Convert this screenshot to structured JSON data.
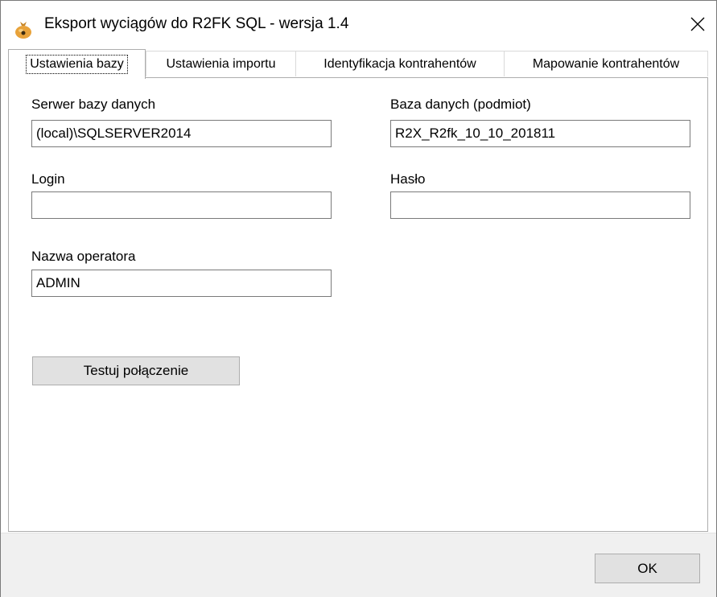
{
  "window": {
    "title": "Eksport wyciągów do R2FK SQL - wersja 1.4",
    "close_glyph": "✕",
    "app_icon": "money-bag-icon"
  },
  "tabs": [
    {
      "label": "Ustawienia bazy",
      "active": true
    },
    {
      "label": "Ustawienia importu",
      "active": false
    },
    {
      "label": "Identyfikacja kontrahentów",
      "active": false
    },
    {
      "label": "Mapowanie kontrahentów",
      "active": false
    }
  ],
  "form": {
    "server_label": "Serwer bazy danych",
    "server_value": "(local)\\SQLSERVER2014",
    "database_label": "Baza danych (podmiot)",
    "database_value": "R2X_R2fk_10_10_201811",
    "login_label": "Login",
    "login_value": "",
    "password_label": "Hasło",
    "password_value": "",
    "operator_label": "Nazwa operatora",
    "operator_value": "ADMIN"
  },
  "buttons": {
    "test_connection": "Testuj połączenie",
    "ok": "OK"
  },
  "colors": {
    "window_bg": "#ffffff",
    "footer_bg": "#f0f0f0",
    "button_bg": "#e1e1e1",
    "border": "#adadad",
    "icon_bag": "#e8a23a"
  }
}
